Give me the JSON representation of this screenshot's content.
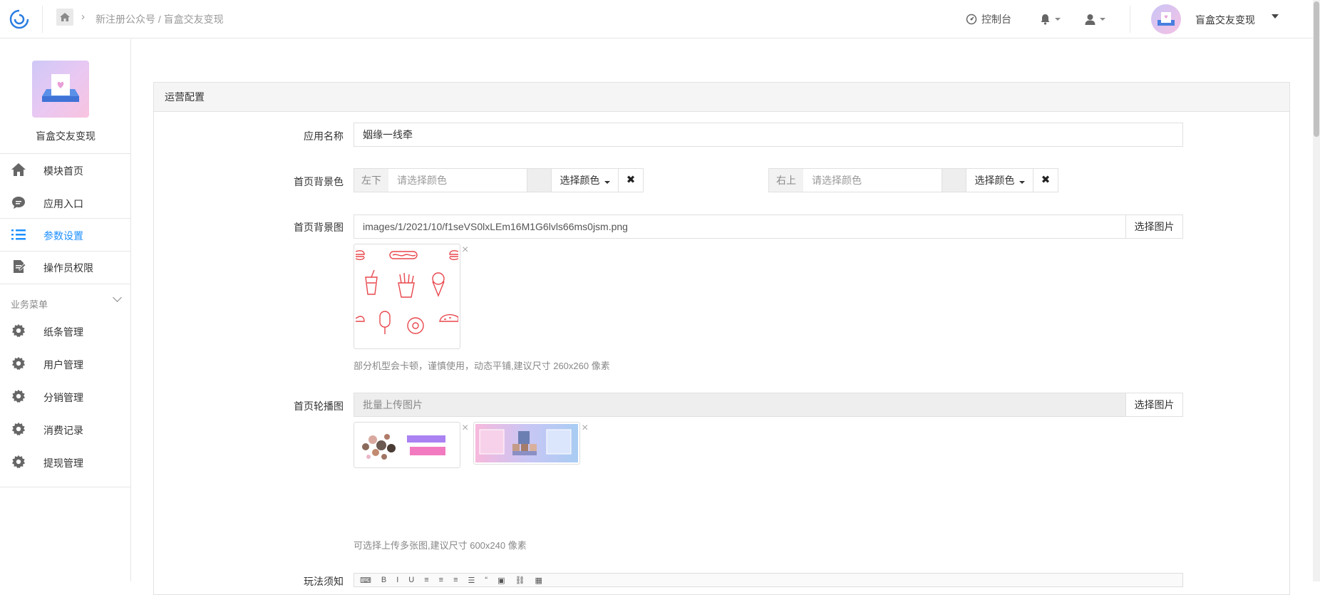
{
  "header": {
    "breadcrumb": "新注册公众号 / 盲盒交友变现",
    "console_label": "控制台",
    "account_name": "盲盒交友变现"
  },
  "sidebar": {
    "app_name": "盲盒交友变现",
    "items": [
      {
        "label": "模块首页",
        "icon": "home-icon"
      },
      {
        "label": "应用入口",
        "icon": "chat-icon"
      },
      {
        "label": "参数设置",
        "icon": "list-icon",
        "active": true
      },
      {
        "label": "操作员权限",
        "icon": "document-icon"
      }
    ],
    "group_label": "业务菜单",
    "business_items": [
      {
        "label": "纸条管理",
        "icon": "gear-icon"
      },
      {
        "label": "用户管理",
        "icon": "gear-icon"
      },
      {
        "label": "分销管理",
        "icon": "gear-icon"
      },
      {
        "label": "消费记录",
        "icon": "gear-icon"
      },
      {
        "label": "提现管理",
        "icon": "gear-icon"
      }
    ]
  },
  "panel": {
    "title": "运营配置",
    "app_name_label": "应用名称",
    "app_name_value": "姻缘一线牵",
    "bg_color_label": "首页背景色",
    "bg_color_left_addon": "左下",
    "bg_color_right_addon": "右上",
    "color_placeholder": "请选择颜色",
    "choose_color_label": "选择颜色",
    "bg_image_label": "首页背景图",
    "bg_image_value": "images/1/2021/10/f1seVS0lxLEm16M1G6lvls66ms0jsm.png",
    "choose_image_label": "选择图片",
    "bg_image_help": "部分机型会卡顿，谨慎使用，动态平铺,建议尺寸 260x260 像素",
    "carousel_label": "首页轮播图",
    "carousel_placeholder": "批量上传图片",
    "carousel_help": "可选择上传多张图,建议尺寸 600x240 像素",
    "rules_label": "玩法须知"
  },
  "colors": {
    "accent": "#1e90ff",
    "food_pattern": "#e8474c"
  }
}
